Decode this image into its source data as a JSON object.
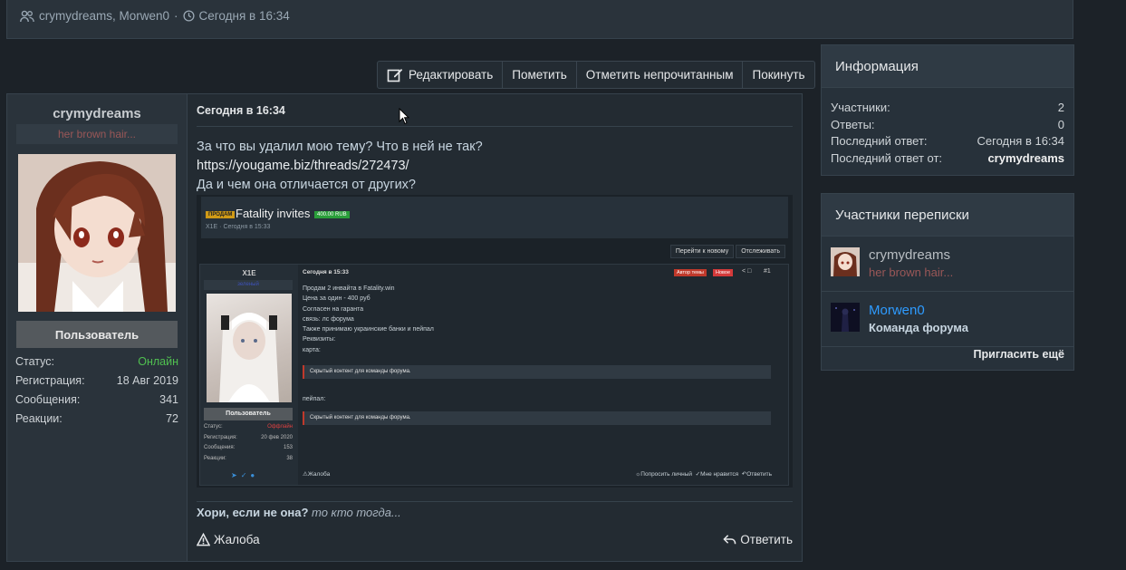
{
  "thread_header": {
    "participants": "crymydreams, Morwen0",
    "separator": "·",
    "date": "Сегодня в 16:34"
  },
  "actions": {
    "edit": "Редактировать",
    "mark": "Пометить",
    "mark_unread": "Отметить непрочитанным",
    "leave": "Покинуть"
  },
  "author": {
    "name": "crymydreams",
    "title": "her brown hair...",
    "banner": "Пользователь",
    "stats": [
      {
        "label": "Статус:",
        "value": "Онлайн"
      },
      {
        "label": "Регистрация:",
        "value": "18 Авг 2019"
      },
      {
        "label": "Сообщения:",
        "value": "341"
      },
      {
        "label": "Реакции:",
        "value": "72"
      }
    ]
  },
  "post": {
    "date": "Сегодня в 16:34",
    "lines": [
      "За что вы удалил мою тему? Что в ней не так?",
      "https://yougame.biz/threads/272473/",
      "Да и чем она отличается от других?"
    ],
    "signature_bold": "Хори, если не она?",
    "signature_italic": "то кто тогда...",
    "report": "Жалоба",
    "reply": "Ответить"
  },
  "embedded": {
    "tag": "ПРОДАМ",
    "title": "Fatality invites",
    "price": "400.00 RUB",
    "meta": "X1E · Сегодня в 15:33",
    "btn_new": "Перейти к новому",
    "btn_watch": "Отслеживать",
    "user": "X1E",
    "user_title": "зеленый",
    "user_banner": "Пользователь",
    "stats": [
      {
        "label": "Статус:",
        "value": "Оффлайн"
      },
      {
        "label": "Регистрация:",
        "value": "20 фев 2020"
      },
      {
        "label": "Сообщения:",
        "value": "153"
      },
      {
        "label": "Реакции:",
        "value": "38"
      }
    ],
    "date": "Сегодня в 15:33",
    "badge_author": "Автор темы",
    "badge_new": "Новое",
    "post_no": "#1",
    "lines": [
      "Продам 2 инвайта в Fatality.win",
      "Цена за один - 400 руб",
      "Согласен на гаранта",
      "связь: лс форума",
      "Также принимаю украинские банки и пейпал",
      "Реквизиты:",
      "карта:"
    ],
    "hidden": "Скрытый контент для команды форума.",
    "paypal": "пейпал:",
    "foot_report": "Жалоба",
    "foot_pm": "Попросить личный",
    "foot_like": "Мне нравится",
    "foot_reply": "Ответить"
  },
  "info_panel": {
    "title": "Информация",
    "rows": [
      {
        "label": "Участники:",
        "value": "2"
      },
      {
        "label": "Ответы:",
        "value": "0"
      },
      {
        "label": "Последний ответ:",
        "value": "Сегодня в 16:34"
      },
      {
        "label": "Последний ответ от:",
        "value": "crymydreams"
      }
    ]
  },
  "participants_panel": {
    "title": "Участники переписки",
    "items": [
      {
        "name": "crymydreams",
        "title": "her brown hair..."
      },
      {
        "name": "Morwen0",
        "title": "Команда форума"
      }
    ],
    "invite": "Пригласить ещё"
  },
  "colors": {
    "online": "#50c050",
    "staff_name": "#2e9bff",
    "user_title": "#9a5757"
  }
}
